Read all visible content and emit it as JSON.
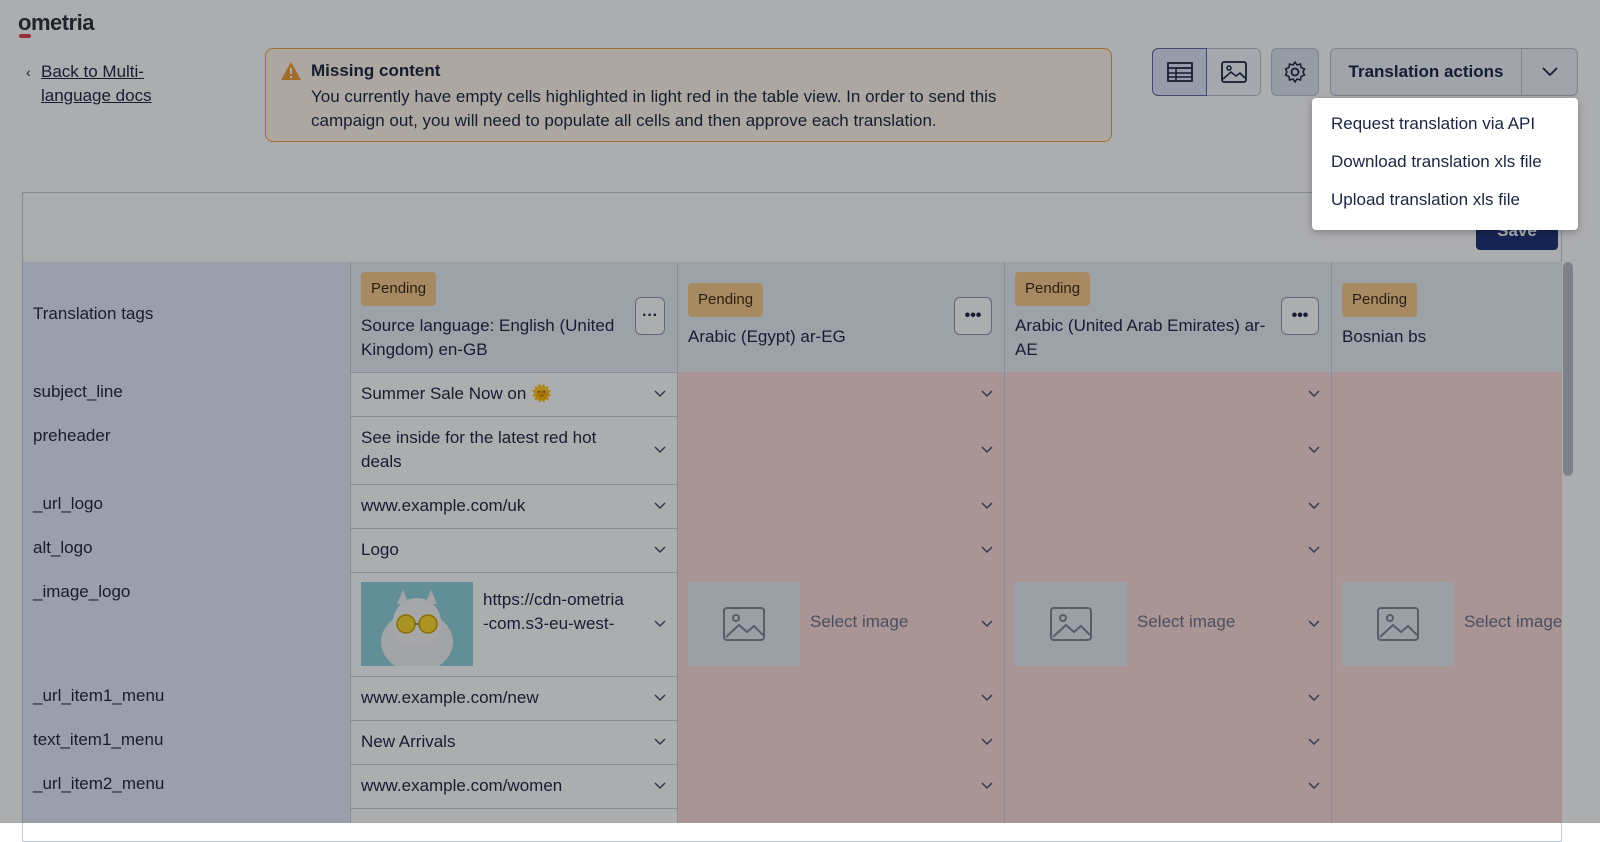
{
  "app": {
    "logo": "ometria"
  },
  "nav": {
    "back_label": "Back to Multi-language docs"
  },
  "alert": {
    "title": "Missing content",
    "message": "You currently have empty cells highlighted in light red in the table view. In order to send this campaign out, you will need to populate all cells and then approve each translation."
  },
  "toolbar": {
    "table_view_icon": "table-icon",
    "image_view_icon": "image-icon",
    "settings_icon": "gear-icon",
    "translation_actions_label": "Translation actions",
    "save_label": "Save"
  },
  "menu": {
    "items": [
      "Request translation via API",
      "Download translation xls file",
      "Upload translation xls file"
    ]
  },
  "table": {
    "tag_header": "Translation tags",
    "columns": [
      {
        "status": "Pending",
        "name": "Source language: English (United Kingdom) en-GB"
      },
      {
        "status": "Pending",
        "name": "Arabic (Egypt) ar-EG"
      },
      {
        "status": "Pending",
        "name": "Arabic (United Arab Emirates) ar-AE"
      },
      {
        "status": "Pending",
        "name": "Bosnian bs"
      }
    ],
    "select_image_label": "Select image",
    "rows": [
      {
        "tag": "subject_line",
        "source": "Summer Sale Now on 🌞"
      },
      {
        "tag": "preheader",
        "source": "See inside for the latest red hot deals"
      },
      {
        "tag": "_url_logo",
        "source": "www.example.com/uk"
      },
      {
        "tag": "alt_logo",
        "source": "Logo"
      },
      {
        "tag": "_image_logo",
        "source": "https://cdn-ometria-com.s3-eu-west-"
      },
      {
        "tag": "_url_item1_menu",
        "source": "www.example.com/new"
      },
      {
        "tag": "text_item1_menu",
        "source": "New Arrivals"
      },
      {
        "tag": "_url_item2_menu",
        "source": "www.example.com/women"
      }
    ]
  },
  "colors": {
    "accent_navy": "#1b2f73",
    "pending_badge": "#f7c98a",
    "empty_cell": "#fbd9da",
    "warning_border": "#f0a03c"
  }
}
